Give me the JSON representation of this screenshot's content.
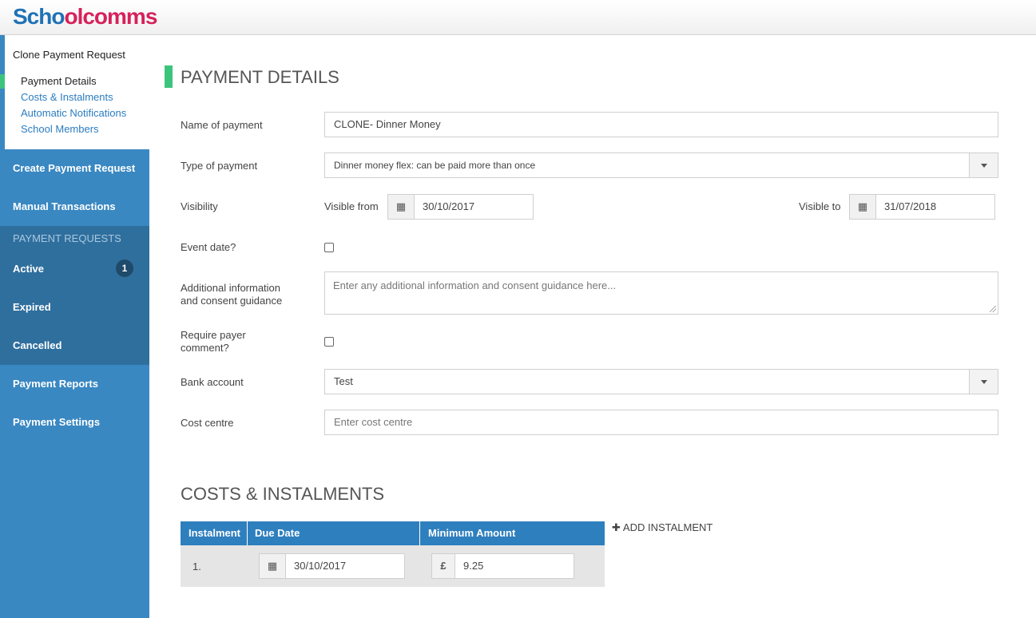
{
  "brand": {
    "part1": "Scho",
    "part2": "o",
    "part3": "lcomms"
  },
  "sidebar": {
    "sub_title": "Clone Payment Request",
    "sub_links": [
      "Payment Details",
      "Costs & Instalments",
      "Automatic Notifications",
      "School Members"
    ],
    "create_label": "Create Payment Request",
    "manual_label": "Manual Transactions",
    "group_heading": "PAYMENT REQUESTS",
    "active_label": "Active",
    "active_count": "1",
    "expired_label": "Expired",
    "cancelled_label": "Cancelled",
    "reports_label": "Payment Reports",
    "settings_label": "Payment Settings"
  },
  "payment_details": {
    "title": "PAYMENT DETAILS",
    "name_label": "Name of payment",
    "name_value": "CLONE- Dinner Money",
    "type_label": "Type of payment",
    "type_value": "Dinner money flex: can be paid more than once",
    "visibility_label": "Visibility",
    "visible_from_label": "Visible from",
    "visible_from_value": "30/10/2017",
    "visible_to_label": "Visible to",
    "visible_to_value": "31/07/2018",
    "event_date_label": "Event date?",
    "additional_info_label": "Additional information and consent guidance",
    "additional_info_placeholder": "Enter any additional information and consent guidance here...",
    "require_comment_label": "Require payer comment?",
    "bank_label": "Bank account",
    "bank_value": "Test",
    "cost_centre_label": "Cost centre",
    "cost_centre_placeholder": "Enter cost centre"
  },
  "costs": {
    "title": "COSTS & INSTALMENTS",
    "columns": [
      "Instalment",
      "Due Date",
      "Minimum Amount"
    ],
    "rows": [
      {
        "number": "1.",
        "due_date": "30/10/2017",
        "currency": "£",
        "amount": "9.25"
      }
    ],
    "add_label": "ADD INSTALMENT"
  },
  "colors": {
    "sidebar": "#3a88c2",
    "sidebar_dark": "#2f6f9e",
    "accent_green": "#3cc47c",
    "table_header": "#2e7fbe",
    "brand_blue": "#1f72b6",
    "brand_pink": "#d6215c"
  }
}
